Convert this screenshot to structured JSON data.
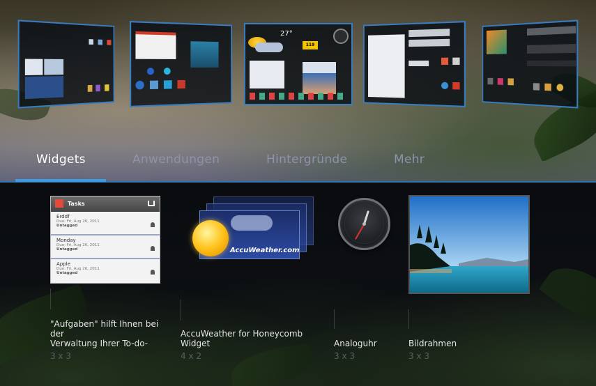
{
  "tabs": [
    {
      "label": "Widgets",
      "active": true
    },
    {
      "label": "Anwendungen",
      "active": false
    },
    {
      "label": "Hintergründe",
      "active": false
    },
    {
      "label": "Mehr",
      "active": false
    }
  ],
  "home_previews": {
    "count": 5,
    "screen2_temperature": "27°",
    "screen2_badge": "119"
  },
  "widgets": [
    {
      "name": "\"Aufgaben\" hilft Ihnen bei der Verwaltung Ihrer To-do-",
      "name_lines": [
        "\"Aufgaben\" hilft Ihnen bei",
        "der",
        "Verwaltung Ihrer To-do-"
      ],
      "size": "3 x 3",
      "preview": {
        "header": "Tasks",
        "tasks": [
          {
            "title": "Erddf",
            "due": "Due: Fri, Aug 26, 2011",
            "tag": "Untagged"
          },
          {
            "title": "Monday",
            "due": "Due: Fri, Aug 26, 2011",
            "tag": "Untagged"
          },
          {
            "title": "Apple",
            "due": "Due: Fri, Aug 26, 2011",
            "tag": "Untagged"
          }
        ]
      }
    },
    {
      "name": "AccuWeather for Honeycomb Widget",
      "name_lines": [
        "AccuWeather for Honeycomb",
        "Widget"
      ],
      "size": "4 x 2",
      "preview": {
        "brand": "AccuWeather.com"
      }
    },
    {
      "name": "Analoguhr",
      "name_lines": [
        "Analoguhr"
      ],
      "size": "3 x 3",
      "preview": {
        "clock_hour": 12,
        "clock_minute": 35
      }
    },
    {
      "name": "Bildrahmen",
      "name_lines": [
        "Bildrahmen"
      ],
      "size": "3 x 3"
    }
  ],
  "colors": {
    "accent": "#3f9be0",
    "tab_inactive": "#8c93ad",
    "screen_border": "#3a7cc0",
    "label": "#e6e6e6",
    "size_label": "#5a5f66"
  },
  "icons": [
    "sun-icon",
    "clock-icon",
    "bell-icon",
    "tasks-app-icon"
  ]
}
